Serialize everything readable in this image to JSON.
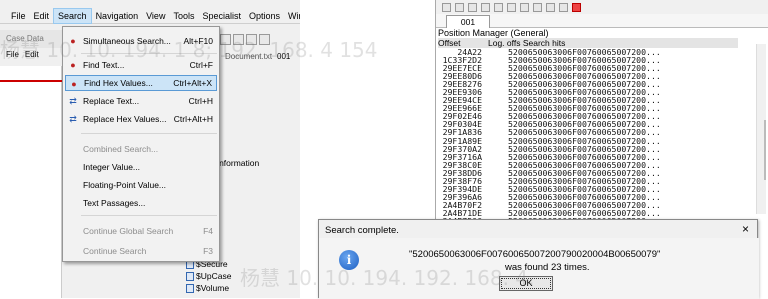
{
  "menubar": {
    "items": [
      "File",
      "Edit",
      "Search",
      "Navigation",
      "View",
      "Tools",
      "Specialist",
      "Options",
      "Window"
    ],
    "active": "Search"
  },
  "background": {
    "case_data": "Case Data",
    "file_menu": "File",
    "edit_menu": "Edit",
    "doc_title": "Document.txt",
    "doc_number": "001",
    "tree": [
      "known",
      "",
      "LE.BIN",
      "rectory)",
      "y Key",
      "Volume Information",
      "f",
      "s",
      "o"
    ],
    "files": [
      "$Secure",
      "$UpCase",
      "$Volume"
    ]
  },
  "search_menu": [
    {
      "label": "Simultaneous Search...",
      "shortcut": "Alt+F10",
      "icon": "binoculars-icon",
      "state": "normal"
    },
    {
      "label": "Find Text...",
      "shortcut": "Ctrl+F",
      "icon": "binoculars-icon",
      "state": "normal"
    },
    {
      "label": "Find Hex Values...",
      "shortcut": "Ctrl+Alt+X",
      "icon": "binoculars-icon",
      "state": "highlighted"
    },
    {
      "label": "Replace Text...",
      "shortcut": "Ctrl+H",
      "icon": "replace-icon",
      "state": "normal"
    },
    {
      "label": "Replace Hex Values...",
      "shortcut": "Ctrl+Alt+H",
      "icon": "replace-icon",
      "state": "normal"
    },
    {
      "label": "Combined Search...",
      "shortcut": "",
      "icon": "",
      "state": "disabled"
    },
    {
      "label": "Integer Value...",
      "shortcut": "",
      "icon": "",
      "state": "normal"
    },
    {
      "label": "Floating-Point Value...",
      "shortcut": "",
      "icon": "",
      "state": "normal"
    },
    {
      "label": "Text Passages...",
      "shortcut": "",
      "icon": "",
      "state": "normal"
    },
    {
      "label": "Continue Global Search",
      "shortcut": "F4",
      "icon": "",
      "state": "disabled"
    },
    {
      "label": "Continue Search",
      "shortcut": "F3",
      "icon": "",
      "state": "disabled"
    }
  ],
  "position_manager": {
    "tab": "001",
    "title": "Position Manager (General)",
    "col_offset": "Offset",
    "col_hits": "Log. offs Search hits",
    "rows": [
      {
        "offset": "24A22",
        "hit": "5200650063006F00760065007200..."
      },
      {
        "offset": "1C33F2D2",
        "hit": "5200650063006F00760065007200..."
      },
      {
        "offset": "29EE7ECE",
        "hit": "5200650063006F00760065007200..."
      },
      {
        "offset": "29EE80D6",
        "hit": "5200650063006F00760065007200..."
      },
      {
        "offset": "29EE8276",
        "hit": "5200650063006F00760065007200..."
      },
      {
        "offset": "29EE9306",
        "hit": "5200650063006F00760065007200..."
      },
      {
        "offset": "29EE94CE",
        "hit": "5200650063006F00760065007200..."
      },
      {
        "offset": "29EE966E",
        "hit": "5200650063006F00760065007200..."
      },
      {
        "offset": "29F02E46",
        "hit": "5200650063006F00760065007200..."
      },
      {
        "offset": "29F0304E",
        "hit": "5200650063006F00760065007200..."
      },
      {
        "offset": "29F1A836",
        "hit": "5200650063006F00760065007200..."
      },
      {
        "offset": "29F1A89E",
        "hit": "5200650063006F00760065007200..."
      },
      {
        "offset": "29F370A2",
        "hit": "5200650063006F00760065007200..."
      },
      {
        "offset": "29F3716A",
        "hit": "5200650063006F00760065007200..."
      },
      {
        "offset": "29F38C0E",
        "hit": "5200650063006F00760065007200..."
      },
      {
        "offset": "29F38DD6",
        "hit": "5200650063006F00760065007200..."
      },
      {
        "offset": "29F38F76",
        "hit": "5200650063006F00760065007200..."
      },
      {
        "offset": "29F394DE",
        "hit": "5200650063006F00760065007200..."
      },
      {
        "offset": "29F396A6",
        "hit": "5200650063006F00760065007200..."
      },
      {
        "offset": "2A4B70F2",
        "hit": "5200650063006F00760065007200..."
      },
      {
        "offset": "2A4B71DE",
        "hit": "5200650063006F00760065007200..."
      },
      {
        "offset": "2A4B7506",
        "hit": "5200650063006F00760065007200..."
      }
    ]
  },
  "dialog": {
    "title": "Search complete.",
    "close": "×",
    "message_line1": "\"5200650063006F00760065007200790020004B00650079\"",
    "message_line2": "was found 23 times.",
    "ok_label": "OK"
  },
  "watermark": {
    "top": "杨慧 10. 10. 194. 1 8; 192. 168. 4 154",
    "bottom": "杨慧 10. 10. 194. 192. 168. 4."
  }
}
